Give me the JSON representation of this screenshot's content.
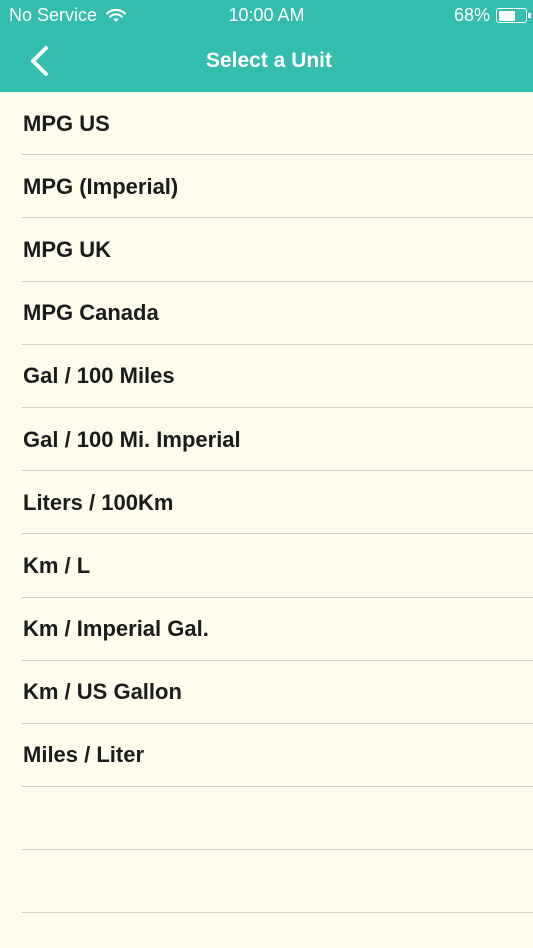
{
  "status_bar": {
    "carrier": "No Service",
    "time": "10:00 AM",
    "battery_percent": "68%",
    "battery_level": 0.68
  },
  "nav": {
    "title": "Select a Unit",
    "back_icon": "chevron-left-icon"
  },
  "colors": {
    "header_bg": "#33bdad",
    "list_bg": "#fefdec",
    "separator": "#cfcfc4",
    "text": "#1b1b1b"
  },
  "units": [
    "MPG US",
    "MPG (Imperial)",
    "MPG UK",
    "MPG Canada",
    "Gal / 100 Miles",
    "Gal / 100 Mi. Imperial",
    "Liters / 100Km",
    "Km / L",
    "Km / Imperial Gal.",
    "Km / US Gallon",
    "Miles / Liter"
  ]
}
